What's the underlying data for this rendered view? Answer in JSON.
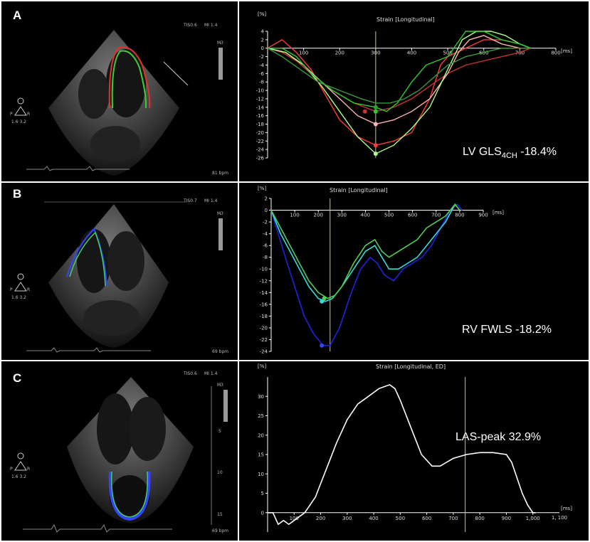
{
  "colors": {
    "background": "#000000",
    "axis": "#ffffff",
    "marker": "#c8c880"
  },
  "panels": [
    {
      "letter": "A",
      "echo": {
        "tis": "TIS0.6",
        "mi": "MI 1.4",
        "scale": "M3",
        "probe_left": "P",
        "probe_right": "R",
        "probe_vals": "1.6   3.2",
        "bpm": "81 bpm",
        "trace_color": "red-green"
      },
      "result": {
        "prefix": "LV GLS",
        "sub": "4CH",
        "value": "  -18.4%"
      }
    },
    {
      "letter": "B",
      "echo": {
        "tis": "TIS0.7",
        "mi": "MI 1.4",
        "scale": "M3",
        "probe_left": "P",
        "probe_right": "R",
        "probe_vals": "1.6   3.2",
        "bpm": "69 bpm",
        "trace_color": "blue-green"
      },
      "result": {
        "prefix": "RV FWLS  -18.2%"
      }
    },
    {
      "letter": "C",
      "echo": {
        "tis": "TIS0.6",
        "mi": "MI 1.4",
        "scale": "M3",
        "probe_left": "P",
        "probe_right": "R",
        "probe_vals": "1.6   3.2",
        "bpm": "69 bpm",
        "depth": [
          "5",
          "10",
          "15"
        ],
        "trace_color": "blue-green"
      },
      "result": {
        "prefix": "LAS-peak  32.9%"
      }
    }
  ],
  "chart_data": [
    {
      "type": "line",
      "title": "Strain [Longitudinal]",
      "ylabel": "[%]",
      "xlabel": "[ms]",
      "xlim": [
        0,
        800
      ],
      "ylim": [
        -26,
        4
      ],
      "xticks": [
        100,
        200,
        300,
        400,
        500,
        600,
        700,
        800
      ],
      "yticks": [
        4,
        2,
        0,
        -2,
        -4,
        -6,
        -8,
        -10,
        -12,
        -14,
        -16,
        -18,
        -20,
        -22,
        -24,
        -26
      ],
      "marker_x": 300,
      "series": [
        {
          "color": "#ff3b3b",
          "x": [
            0,
            40,
            80,
            120,
            160,
            200,
            250,
            300,
            350,
            400,
            450,
            480,
            500,
            550,
            600,
            650,
            700,
            730
          ],
          "y": [
            0,
            2,
            -1,
            -5,
            -11,
            -17,
            -21,
            -23,
            -22,
            -20,
            -12,
            -4,
            -2,
            0,
            2,
            2,
            1,
            0
          ]
        },
        {
          "color": "#c83232",
          "x": [
            0,
            40,
            80,
            120,
            180,
            240,
            300,
            350,
            400,
            450,
            500,
            550,
            600,
            650,
            700,
            730
          ],
          "y": [
            0,
            -1,
            -3,
            -6,
            -10,
            -13,
            -15,
            -14,
            -12,
            -9,
            -6,
            -4,
            -3,
            -2,
            -1,
            0
          ]
        },
        {
          "color": "#ffb4b4",
          "x": [
            0,
            50,
            100,
            150,
            200,
            250,
            300,
            350,
            400,
            450,
            500,
            530,
            560,
            600,
            650,
            700,
            730
          ],
          "y": [
            0,
            -1,
            -4,
            -8,
            -12,
            -16,
            -18,
            -17,
            -15,
            -12,
            -6,
            -1,
            2,
            3,
            1,
            0,
            0
          ]
        },
        {
          "color": "#aaff88",
          "x": [
            0,
            50,
            100,
            150,
            200,
            250,
            300,
            350,
            400,
            450,
            500,
            540,
            580,
            620,
            660,
            700,
            730
          ],
          "y": [
            0,
            -1,
            -4,
            -9,
            -15,
            -21,
            -25,
            -23,
            -19,
            -14,
            -5,
            2,
            4,
            4,
            3,
            1,
            0
          ]
        },
        {
          "color": "#2ecc2e",
          "x": [
            0,
            40,
            80,
            120,
            180,
            240,
            300,
            330,
            360,
            400,
            440,
            470,
            500,
            550,
            600,
            650,
            700,
            730
          ],
          "y": [
            0,
            0,
            -2,
            -6,
            -10,
            -13,
            -14,
            -15,
            -13,
            -8,
            -4,
            -3,
            -2,
            4,
            4,
            2,
            1,
            0
          ]
        },
        {
          "color": "#3a9a3a",
          "x": [
            0,
            40,
            90,
            140,
            200,
            260,
            300,
            340,
            380,
            420,
            460,
            500,
            550,
            600,
            650,
            700,
            730
          ],
          "y": [
            0,
            -2,
            -5,
            -8,
            -10,
            -12,
            -13,
            -13,
            -12,
            -10,
            -7,
            -4,
            -2,
            -1,
            0,
            0,
            0
          ]
        }
      ],
      "peaks": [
        {
          "x": 300,
          "y": -25,
          "color": "#aaff88"
        },
        {
          "x": 300,
          "y": -23,
          "color": "#ff3b3b"
        },
        {
          "x": 300,
          "y": -18,
          "color": "#ffb4b4"
        },
        {
          "x": 300,
          "y": -15,
          "color": "#2ecc2e"
        },
        {
          "x": 300,
          "y": -14,
          "color": "#3a9a3a"
        },
        {
          "x": 270,
          "y": -15,
          "color": "#c83232"
        }
      ]
    },
    {
      "type": "line",
      "title": "Strain [Longitudinal]",
      "ylabel": "[%]",
      "xlabel": "[ms]",
      "xlim": [
        0,
        900
      ],
      "ylim": [
        -24,
        2
      ],
      "xticks": [
        100,
        200,
        300,
        400,
        500,
        600,
        700,
        800,
        900
      ],
      "yticks": [
        2,
        0,
        -2,
        -4,
        -6,
        -8,
        -10,
        -12,
        -14,
        -16,
        -18,
        -20,
        -22,
        -24
      ],
      "marker_x": 250,
      "series": [
        {
          "color": "#2222dd",
          "x": [
            0,
            30,
            60,
            100,
            140,
            180,
            220,
            250,
            290,
            340,
            380,
            420,
            450,
            480,
            520,
            560,
            600,
            640,
            680,
            720,
            760,
            790,
            810
          ],
          "y": [
            0,
            -4,
            -8,
            -13,
            -18,
            -21,
            -23,
            -23,
            -20,
            -14,
            -10,
            -8,
            -9,
            -11,
            -12,
            -10,
            -9,
            -8,
            -6,
            -3,
            0,
            1,
            0
          ]
        },
        {
          "color": "#33dddd",
          "x": [
            0,
            40,
            80,
            120,
            160,
            200,
            230,
            260,
            300,
            350,
            400,
            440,
            470,
            500,
            540,
            580,
            620,
            660,
            700,
            740,
            780,
            800
          ],
          "y": [
            0,
            -4,
            -7,
            -10,
            -13,
            -15,
            -15.5,
            -15,
            -13,
            -10,
            -7,
            -6,
            -8,
            -10,
            -10,
            -9,
            -8,
            -6,
            -4,
            -2,
            1,
            0
          ]
        },
        {
          "color": "#55cc55",
          "x": [
            0,
            40,
            80,
            120,
            160,
            200,
            240,
            270,
            300,
            350,
            400,
            440,
            470,
            500,
            540,
            580,
            620,
            660,
            700,
            740,
            780,
            800
          ],
          "y": [
            0,
            -3,
            -6,
            -9,
            -12,
            -14,
            -15,
            -14.5,
            -13,
            -9,
            -6,
            -5,
            -7,
            -8,
            -7,
            -6,
            -5,
            -3,
            -2,
            -1,
            1,
            0
          ]
        }
      ],
      "peaks": [
        {
          "x": 215,
          "y": -23,
          "color": "#3344ff"
        },
        {
          "x": 215,
          "y": -15.5,
          "color": "#33dddd"
        },
        {
          "x": 225,
          "y": -15,
          "color": "#55cc55"
        }
      ]
    },
    {
      "type": "line",
      "title": "Strain [Longitudinal, ED]",
      "ylabel": "[%]",
      "xlabel": "[ms]",
      "xlim": [
        0,
        1100
      ],
      "ylim": [
        -5,
        35
      ],
      "xticks": [
        100,
        200,
        300,
        400,
        500,
        600,
        700,
        800,
        900,
        1000
      ],
      "xticklabels": [
        "100",
        "200",
        "300",
        "400",
        "500",
        "600",
        "700",
        "800",
        "900",
        "1,000"
      ],
      "xlim_label": "1, 100",
      "yticks": [
        30,
        25,
        20,
        15,
        10,
        5,
        0
      ],
      "marker_x": 745,
      "series": [
        {
          "color": "#ffffff",
          "x": [
            0,
            20,
            40,
            60,
            80,
            100,
            140,
            180,
            220,
            260,
            300,
            340,
            380,
            420,
            460,
            480,
            500,
            540,
            580,
            620,
            650,
            700,
            750,
            800,
            850,
            900,
            920,
            940,
            960,
            980,
            1000,
            1010
          ],
          "y": [
            0,
            0,
            -3,
            -2,
            -3,
            -2,
            0,
            4,
            11,
            18,
            24,
            28,
            30,
            32,
            33,
            32,
            29,
            22,
            15,
            12,
            12,
            14,
            15,
            15.5,
            15.5,
            15,
            13,
            9,
            5,
            2,
            0,
            0
          ]
        }
      ],
      "peaks": []
    }
  ]
}
